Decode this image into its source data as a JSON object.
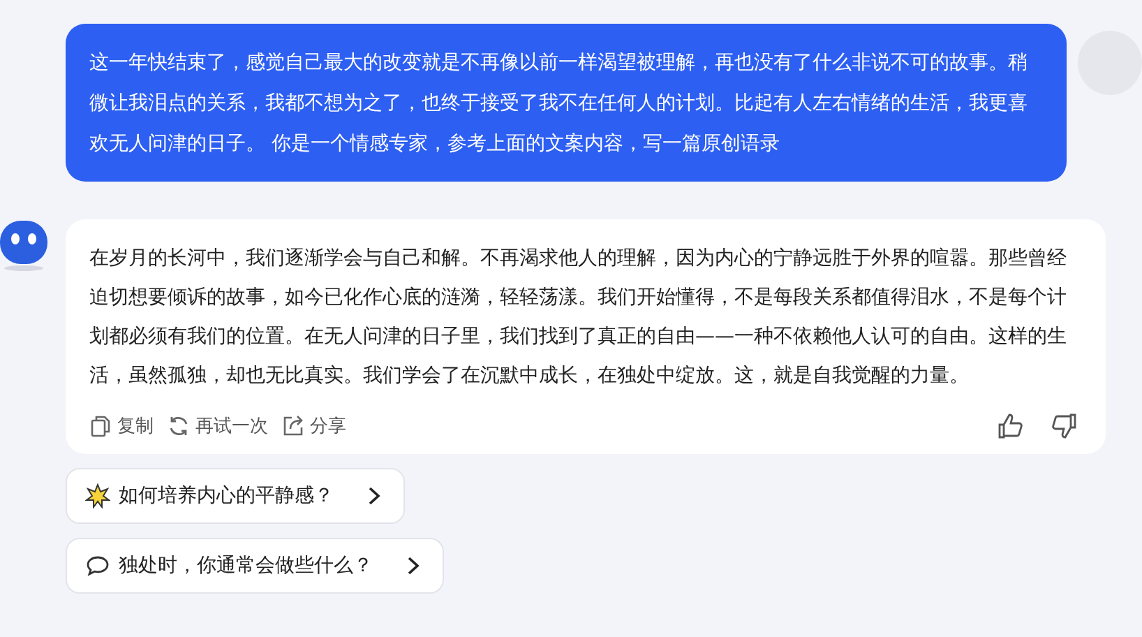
{
  "user_message": {
    "text": "这一年快结束了，感觉自己最大的改变就是不再像以前一样渴望被理解，再也没有了什么非说不可的故事。稍微让我泪点的关系，我都不想为之了，也终于接受了我不在任何人的计划。比起有人左右情绪的生活，我更喜欢无人问津的日子。 你是一个情感专家，参考上面的文案内容，写一篇原创语录"
  },
  "reply": {
    "text": "在岁月的长河中，我们逐渐学会与自己和解。不再渴求他人的理解，因为内心的宁静远胜于外界的喧嚣。那些曾经迫切想要倾诉的故事，如今已化作心底的涟漪，轻轻荡漾。我们开始懂得，不是每段关系都值得泪水，不是每个计划都必须有我们的位置。在无人问津的日子里，我们找到了真正的自由——一种不依赖他人认可的自由。这样的生活，虽然孤独，却也无比真实。我们学会了在沉默中成长，在独处中绽放。这，就是自我觉醒的力量。",
    "actions": [
      {
        "kind": "copy",
        "label": "复制"
      },
      {
        "kind": "retry",
        "label": "再试一次"
      },
      {
        "kind": "share",
        "label": "分享"
      }
    ]
  },
  "suggestions": [
    {
      "kind": "spark",
      "text": "如何培养内心的平静感？"
    },
    {
      "kind": "chat",
      "text": "独处时，你通常会做些什么？"
    }
  ]
}
